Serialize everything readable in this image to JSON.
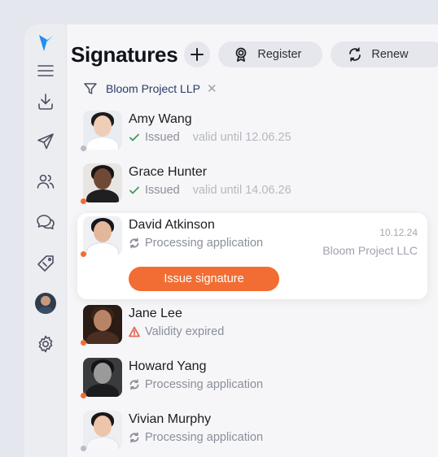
{
  "header": {
    "title": "Signatures",
    "register_label": "Register",
    "renew_label": "Renew"
  },
  "filter": {
    "label": "Bloom Project LLP",
    "clear_glyph": "✕"
  },
  "sidebar": {
    "items": [
      {
        "icon": "logo-icon"
      },
      {
        "icon": "menu-icon"
      },
      {
        "icon": "download-icon"
      },
      {
        "icon": "send-icon"
      },
      {
        "icon": "users-icon"
      },
      {
        "icon": "chat-icon"
      },
      {
        "icon": "tag-icon"
      },
      {
        "icon": "user-avatar"
      },
      {
        "icon": "gear-icon"
      }
    ]
  },
  "colors": {
    "accent": "#f26d33",
    "issued_check": "#3e9b55",
    "expired_warning": "#e06a5a",
    "dot_orange": "#f26d33",
    "dot_gray": "#b8bcc4"
  },
  "signatures": [
    {
      "name": "Amy Wang",
      "status": "Issued",
      "status_icon": "check-icon",
      "validity": "valid until 12.06.25",
      "dot": "gray"
    },
    {
      "name": "Grace Hunter",
      "status": "Issued",
      "status_icon": "check-icon",
      "validity": "valid until 14.06.26",
      "dot": "orange"
    },
    {
      "name": "David Atkinson",
      "status": "Processing application",
      "status_icon": "refresh-icon",
      "date": "10.12.24",
      "company": "Bloom Project LLC",
      "action_label": "Issue signature",
      "dot": "orange",
      "selected": true
    },
    {
      "name": "Jane Lee",
      "status": "Validity expired",
      "status_icon": "warning-icon",
      "dot": "orange"
    },
    {
      "name": "Howard Yang",
      "status": "Processing application",
      "status_icon": "refresh-icon",
      "dot": "orange"
    },
    {
      "name": "Vivian Murphy",
      "status": "Processing application",
      "status_icon": "refresh-icon",
      "dot": "gray"
    }
  ]
}
